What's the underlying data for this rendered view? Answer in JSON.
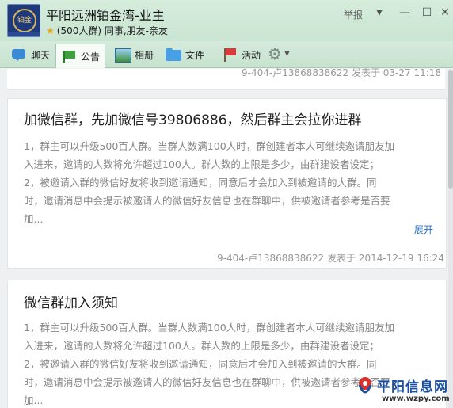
{
  "header": {
    "title": "平阳远洲铂金湾-业主",
    "subtitle": "(500人群) 同事,朋友-亲友",
    "avatar_text": "铂金湾",
    "report_label": "举报",
    "caret": "▾",
    "minimize": "—",
    "maximize": "☐",
    "close": "✕"
  },
  "tabs": [
    {
      "label": "聊天",
      "icon": "chat-icon"
    },
    {
      "label": "公告",
      "icon": "notice-icon",
      "active": true
    },
    {
      "label": "相册",
      "icon": "album-icon"
    },
    {
      "label": "文件",
      "icon": "file-icon"
    },
    {
      "label": "活动",
      "icon": "event-icon"
    }
  ],
  "settings": {
    "icon": "gear-icon",
    "gear": "⚙",
    "caret": "▼"
  },
  "announcements": {
    "previous_meta": "9-404-卢13868838622 发表于 03-27 11:18",
    "items": [
      {
        "title": "加微信群，先加微信号39806886，然后群主会拉你进群",
        "lines": [
          "1，群主可以升级500百人群。当群人数满100人时，群创建者本人可继续邀请朋友加",
          "入进来，邀请的人数将允许超过100人。群人数的上限是多少，由群建设者设定；",
          "2，被邀请入群的微信好友将收到邀请通知，同意后才会加入到被邀请的大群。同",
          "时，邀请消息中会提示被邀请人的微信好友信息也在群聊中，供被邀请者参考是否要",
          "加..."
        ],
        "expand_label": "展开",
        "meta": "9-404-卢13868838622 发表于 2014-12-19 16:24"
      },
      {
        "title": "微信群加入须知",
        "lines": [
          "1，群主可以升级500百人群。当群人数满100人时，群创建者本人可继续邀请朋友加",
          "入进来，邀请的人数将允许超过100人。群人数的上限是多少，由群建设者设定；",
          "2，被邀请入群的微信好友将收到邀请通知，同意后才会加入到被邀请的大群。同",
          "时，邀请消息中会提示被邀请人的微信好友信息也在群聊中，供被邀请者参考是否要",
          "加..."
        ]
      }
    ]
  },
  "watermark": {
    "name": "平阳信息网",
    "url": "www.wzpy.com"
  }
}
